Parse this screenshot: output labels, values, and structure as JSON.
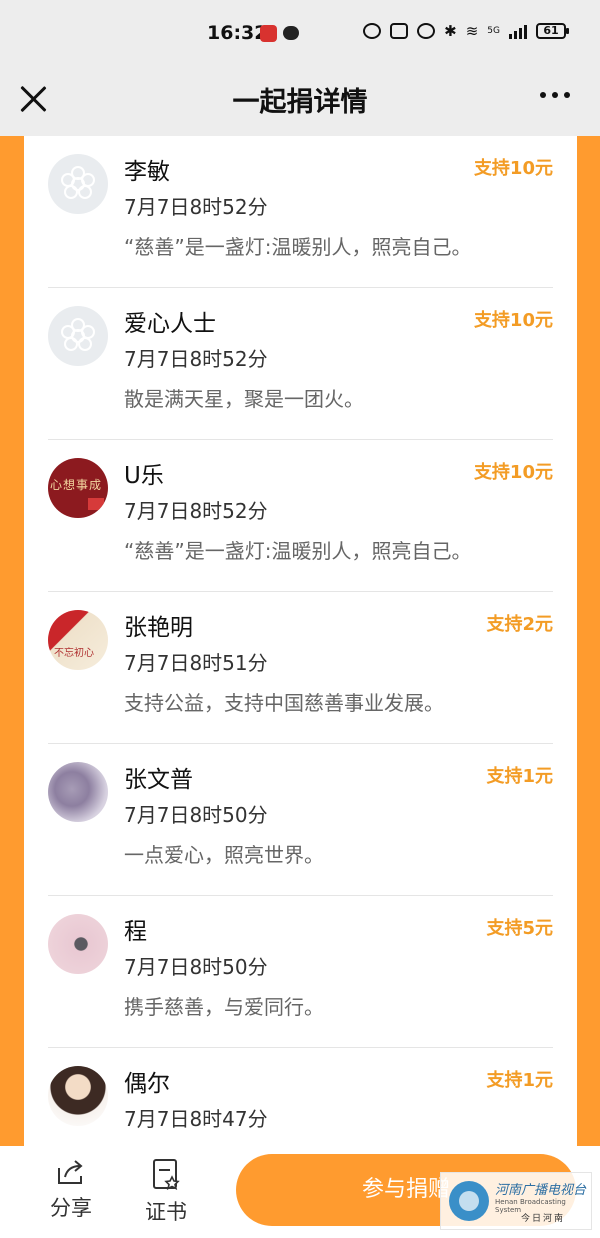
{
  "status_bar": {
    "time": "16:32",
    "network": "5G",
    "battery": "61"
  },
  "nav": {
    "title": "一起捐详情"
  },
  "donations": [
    {
      "name": "李敏",
      "time": "7月7日8时52分",
      "message": "“慈善”是一盏灯:温暖别人，照亮自己。",
      "amount": "支持10元",
      "avatar": "default"
    },
    {
      "name": "爱心人士",
      "time": "7月7日8时52分",
      "message": "散是满天星，聚是一团火。",
      "amount": "支持10元",
      "avatar": "default"
    },
    {
      "name": "U乐",
      "time": "7月7日8时52分",
      "message": "“慈善”是一盏灯:温暖别人，照亮自己。",
      "amount": "支持10元",
      "avatar": "photo",
      "avatar_text": "心想事成"
    },
    {
      "name": "张艳明",
      "time": "7月7日8时51分",
      "message": "支持公益，支持中国慈善事业发展。",
      "amount": "支持2元",
      "avatar": "photo",
      "avatar_text": "不忘初心"
    },
    {
      "name": "张文普",
      "time": "7月7日8时50分",
      "message": "一点爱心，照亮世界。",
      "amount": "支持1元",
      "avatar": "photo"
    },
    {
      "name": "程",
      "time": "7月7日8时50分",
      "message": "携手慈善，与爱同行。",
      "amount": "支持5元",
      "avatar": "photo"
    },
    {
      "name": "偶尔",
      "time": "7月7日8时47分",
      "message": "",
      "amount": "支持1元",
      "avatar": "photo"
    }
  ],
  "bottom": {
    "share_label": "分享",
    "cert_label": "证书",
    "join_label": "参与捐赠"
  },
  "watermark": {
    "cn": "河南广播电视台",
    "en": "Henan Broadcasting System",
    "sub": "今日河南"
  },
  "colors": {
    "accent": "#ff9b2f",
    "amount": "#f39c25"
  }
}
